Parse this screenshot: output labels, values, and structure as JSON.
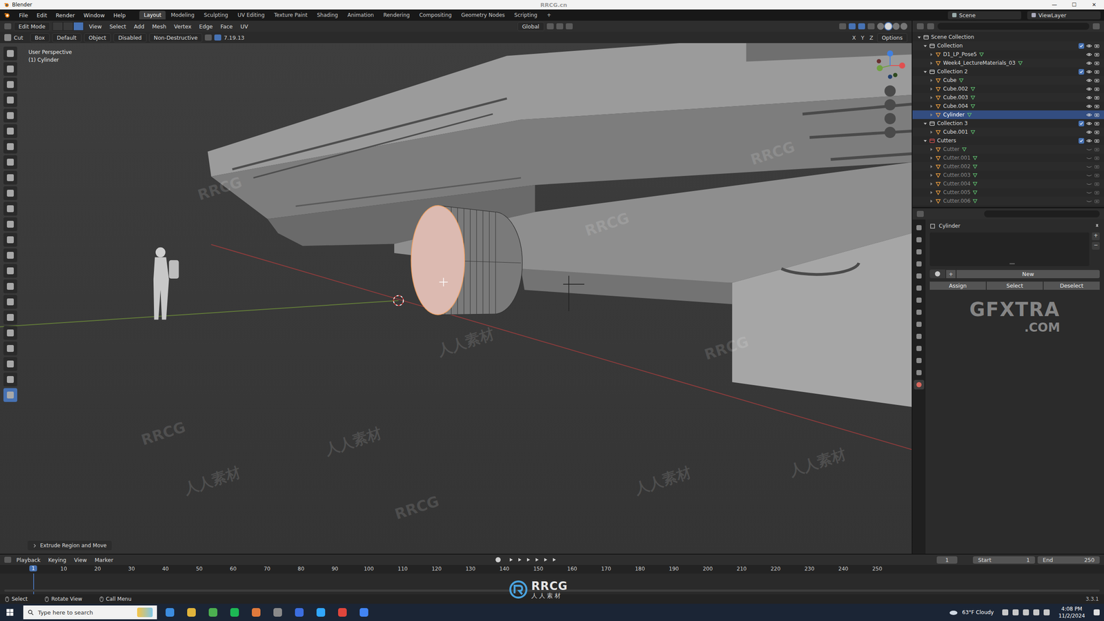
{
  "window": {
    "title": "Blender",
    "watermark": "RRCG.cn",
    "controls": [
      "—",
      "☐",
      "✕"
    ]
  },
  "menu": [
    "File",
    "Edit",
    "Render",
    "Window",
    "Help"
  ],
  "workspaces": [
    {
      "label": "Layout",
      "selected": true
    },
    {
      "label": "Modeling",
      "selected": false
    },
    {
      "label": "Sculpting",
      "selected": false
    },
    {
      "label": "UV Editing",
      "selected": false
    },
    {
      "label": "Texture Paint",
      "selected": false
    },
    {
      "label": "Shading",
      "selected": false
    },
    {
      "label": "Animation",
      "selected": false
    },
    {
      "label": "Rendering",
      "selected": false
    },
    {
      "label": "Compositing",
      "selected": false
    },
    {
      "label": "Geometry Nodes",
      "selected": false
    },
    {
      "label": "Scripting",
      "selected": false
    }
  ],
  "add_workspace": "+",
  "scene": "Scene",
  "view_layer": "ViewLayer",
  "viewport_header": {
    "mode": "Edit Mode",
    "select_modes": [
      {
        "selected": false
      },
      {
        "selected": false
      },
      {
        "selected": true
      }
    ],
    "menus": [
      "View",
      "Select",
      "Add",
      "Mesh",
      "Vertex",
      "Edge",
      "Face",
      "UV"
    ],
    "orientation": "Global"
  },
  "tool_settings": {
    "tool": "Cut",
    "shape": "Box",
    "operation": "Default",
    "orientation": "Object",
    "snap": "Disabled",
    "mode": "Non-Destructive",
    "version": "7.19.13",
    "axes": [
      "X",
      "Y",
      "Z"
    ],
    "options": "Options"
  },
  "toolbar": [
    {
      "selected": false
    },
    {
      "selected": false
    },
    {
      "selected": false
    },
    {
      "selected": false
    },
    {
      "selected": false
    },
    {
      "selected": false
    },
    {
      "selected": false
    },
    {
      "selected": false
    },
    {
      "selected": false
    },
    {
      "selected": false
    },
    {
      "selected": false
    },
    {
      "selected": false
    },
    {
      "selected": false
    },
    {
      "selected": false
    },
    {
      "selected": false
    },
    {
      "selected": false
    },
    {
      "selected": false
    },
    {
      "selected": false
    },
    {
      "selected": false
    },
    {
      "selected": false
    },
    {
      "selected": false
    },
    {
      "selected": false
    },
    {
      "selected": true
    }
  ],
  "viewport": {
    "view": "User Perspective",
    "object": "(1) Cylinder",
    "last_operator": "Extrude Region and Move"
  },
  "outliner": {
    "root": "Scene Collection",
    "collections": [
      {
        "name": "Collection",
        "expanded": true,
        "checked": true,
        "color": "#e0e0e0",
        "items": [
          {
            "name": "D1_LP_Pose5",
            "selected": false,
            "hidden": false
          },
          {
            "name": "Week4_LectureMaterials_03",
            "selected": false,
            "hidden": false
          }
        ]
      },
      {
        "name": "Collection 2",
        "expanded": true,
        "checked": true,
        "color": "#e0e0e0",
        "items": [
          {
            "name": "Cube",
            "selected": false,
            "hidden": false
          },
          {
            "name": "Cube.002",
            "selected": false,
            "hidden": false
          },
          {
            "name": "Cube.003",
            "selected": false,
            "hidden": false
          },
          {
            "name": "Cube.004",
            "selected": false,
            "hidden": false
          },
          {
            "name": "Cylinder",
            "selected": true,
            "hidden": false
          }
        ]
      },
      {
        "name": "Collection 3",
        "expanded": true,
        "checked": true,
        "color": "#e0e0e0",
        "items": [
          {
            "name": "Cube.001",
            "selected": false,
            "hidden": false
          }
        ]
      },
      {
        "name": "Cutters",
        "expanded": true,
        "checked": true,
        "color": "#e05050",
        "items": [
          {
            "name": "Cutter",
            "selected": false,
            "hidden": true
          },
          {
            "name": "Cutter.001",
            "selected": false,
            "hidden": true
          },
          {
            "name": "Cutter.002",
            "selected": false,
            "hidden": true
          },
          {
            "name": "Cutter.003",
            "selected": false,
            "hidden": true
          },
          {
            "name": "Cutter.004",
            "selected": false,
            "hidden": true
          },
          {
            "name": "Cutter.005",
            "selected": false,
            "hidden": true
          },
          {
            "name": "Cutter.006",
            "selected": false,
            "hidden": true
          }
        ]
      }
    ]
  },
  "properties": {
    "object": "Cylinder",
    "list_buttons": [
      "+",
      "−"
    ],
    "add": "+",
    "new": "New",
    "buttons": [
      "Assign",
      "Select",
      "Deselect"
    ],
    "tabs": [
      {
        "selected": false
      },
      {
        "selected": false
      },
      {
        "selected": false
      },
      {
        "selected": false
      },
      {
        "selected": false
      },
      {
        "selected": false
      },
      {
        "selected": false
      },
      {
        "selected": false
      },
      {
        "selected": false
      },
      {
        "selected": false
      },
      {
        "selected": false
      },
      {
        "selected": false
      },
      {
        "selected": false
      },
      {
        "selected": true
      }
    ]
  },
  "timeline": {
    "menus": [
      "Playback",
      "Keying",
      "View",
      "Marker"
    ],
    "current": "1",
    "start_label": "Start",
    "start": "1",
    "end_label": "End",
    "end": "250",
    "ticks": [
      "10",
      "20",
      "30",
      "40",
      "50",
      "60",
      "70",
      "80",
      "90",
      "100",
      "110",
      "120",
      "130",
      "140",
      "150",
      "160",
      "170",
      "180",
      "190",
      "200",
      "210",
      "220",
      "230",
      "240",
      "250"
    ]
  },
  "status": {
    "items": [
      "Select",
      "Rotate View",
      "Call Menu"
    ],
    "version": "3.3.1"
  },
  "taskbar": {
    "search": "Type here to search",
    "weather": "63°F Cloudy",
    "time": "4:08 PM",
    "date": "11/2/2024"
  },
  "watermarks": {
    "tiles": [
      "RRCG",
      "人人素材"
    ],
    "logo": [
      "RRCG",
      "人人素材"
    ],
    "badge": [
      "GFXTRA",
      ".COM"
    ]
  }
}
